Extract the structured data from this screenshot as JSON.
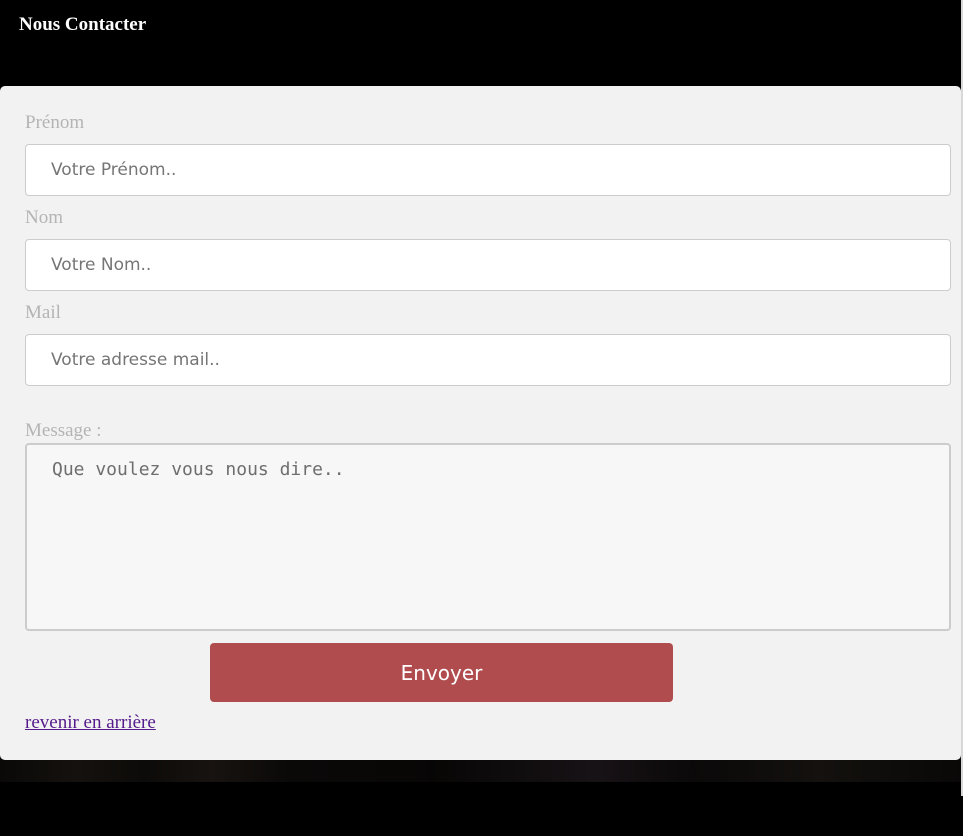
{
  "header": {
    "title": "Nous Contacter"
  },
  "form": {
    "prenom": {
      "label": "Prénom",
      "placeholder": "Votre Prénom..",
      "value": ""
    },
    "nom": {
      "label": "Nom",
      "placeholder": "Votre Nom..",
      "value": ""
    },
    "mail": {
      "label": "Mail",
      "placeholder": "Votre adresse mail..",
      "value": ""
    },
    "message": {
      "label": "Message :",
      "placeholder": "Que voulez vous nous dire..",
      "value": ""
    },
    "submit_label": "Envoyer"
  },
  "footer": {
    "back_link": "revenir en arrière"
  },
  "colors": {
    "page_background": "#000000",
    "panel_background": "#f2f2f2",
    "button_background": "#b04c4e",
    "button_text": "#ffffff",
    "label_text": "#b4b4b4",
    "link_visited": "#551a8b"
  }
}
